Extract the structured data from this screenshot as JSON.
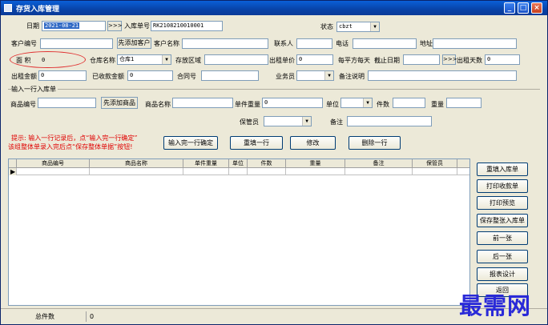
{
  "window": {
    "title": "存货入库管理"
  },
  "header": {
    "date_label": "日期",
    "date_value": "2021-08-21",
    "date_nav": ">>>",
    "receipt_label": "入库单号",
    "receipt_value": "RK2108210010001",
    "status_label": "状态",
    "status_value": "cbzt"
  },
  "row2": {
    "customer_no_label": "客户编号",
    "add_customer_button": "先添加客户",
    "customer_name_label": "客户名称",
    "contact_label": "联系人",
    "phone_label": "电话",
    "address_label": "地址"
  },
  "row3": {
    "area_label": "面  积",
    "area_value": "0",
    "warehouse_label": "仓库名称",
    "warehouse_value": "仓库1",
    "storage_area_label": "存放区域",
    "rent_price_label": "出租单价",
    "rent_price_value": "0",
    "per_sqm_day_label": "每平方每天",
    "end_date_label": "截止日期",
    "end_date_nav": ">>>",
    "rent_days_label": "出租天数",
    "rent_days_value": "0"
  },
  "row4": {
    "rent_amount_label": "出租金额",
    "rent_amount_value": "0",
    "received_label": "已收款金额",
    "received_value": "0",
    "contract_label": "合同号",
    "salesman_label": "业务员",
    "remark_label": "备注说明"
  },
  "entry": {
    "group_title": "输入一行入库单",
    "product_no_label": "商品编号",
    "add_product_button": "先添加商品",
    "product_name_label": "商品名称",
    "unit_weight_label": "单件重量",
    "unit_weight_value": "0",
    "unit_label": "单位",
    "pieces_label": "件数",
    "weight_label": "重量",
    "keeper_label": "保管员",
    "note_label": "备注"
  },
  "tips": {
    "line1": "提示: 输入一行记录后，点“输入完一行确定”",
    "line2": "  该组整体单录入完后点“保存整体单据”按钮!"
  },
  "actions": {
    "confirm_row": "输入完一行确定",
    "refill_row": "重填一行",
    "modify": "修改",
    "delete_row": "删除一行"
  },
  "grid": {
    "columns": [
      "商品编号",
      "商品名称",
      "单件重量",
      "单位",
      "件数",
      "重量",
      "备注",
      "保管员"
    ],
    "current_row_marker": "▶"
  },
  "side_buttons": {
    "refill_receipt": "重填入库单",
    "print_receipt": "打印收款单",
    "print_preview": "打印预览",
    "save_all": "保存整张入库单",
    "prev": "前一张",
    "next": "后一张",
    "report_design": "报表设计",
    "back": "返回"
  },
  "status": {
    "total_pieces_label": "总件数",
    "total_pieces_value": "0"
  },
  "watermark": "最需网"
}
